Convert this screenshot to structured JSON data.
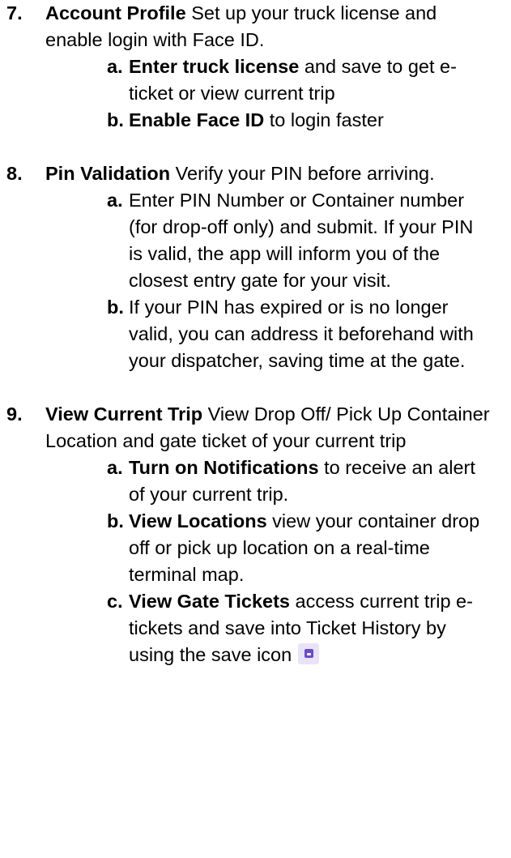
{
  "steps": [
    {
      "number": "7.",
      "title": "Account Profile",
      "text": " Set up your truck license and enable login with Face ID.",
      "items": [
        {
          "letter": "a.",
          "bold": "Enter truck license",
          "text": " and save to get e-ticket or view current trip"
        },
        {
          "letter": "b.",
          "bold": "Enable Face ID",
          "text": " to login faster"
        }
      ]
    },
    {
      "number": "8.",
      "title": "Pin Validation",
      "text": " Verify your PIN before arriving.",
      "items": [
        {
          "letter": "a.",
          "bold": "",
          "text": "Enter PIN Number or Container number (for drop-off only) and submit. If your PIN is valid, the app will inform you of the closest entry gate for your visit."
        },
        {
          "letter": "b.",
          "bold": "",
          "text": "If your PIN has expired or is no longer valid, you can address it beforehand with your dispatcher, saving time at the gate."
        }
      ]
    },
    {
      "number": "9.",
      "title": "View Current Trip",
      "text": " View Drop Off/ Pick Up Container Location and gate ticket of your current trip",
      "items": [
        {
          "letter": "a.",
          "bold": "Turn on Notifications",
          "text": " to receive an alert of your current trip."
        },
        {
          "letter": "b.",
          "bold": "View Locations",
          "text": " view your container drop off or pick up location on a real-time terminal map."
        },
        {
          "letter": "c.",
          "bold": "View Gate Tickets",
          "text": " access current trip e-tickets and save into Ticket History by using the save icon"
        }
      ]
    }
  ],
  "icons": {
    "save": "save-icon"
  },
  "colors": {
    "save_icon_bg": "#e9e3f7",
    "save_icon_fg": "#6a4ad6"
  }
}
